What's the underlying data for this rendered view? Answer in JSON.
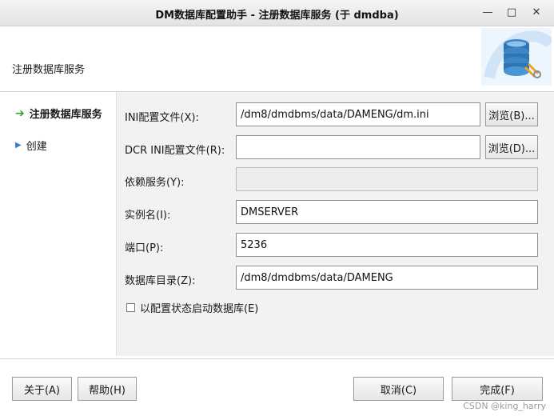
{
  "window": {
    "title": "DM数据库配置助手 - 注册数据库服务 (于 dmdba)",
    "minimize_glyph": "—",
    "maximize_glyph": "□",
    "close_glyph": "✕"
  },
  "header": {
    "title": "注册数据库服务",
    "logo_icon": "database-gear-icon"
  },
  "nav": {
    "items": [
      {
        "label": "注册数据库服务",
        "state": "active",
        "icon": "arrow-right-icon",
        "glyph": "➔",
        "color": "#2e9e3a"
      },
      {
        "label": "创建",
        "state": "pending",
        "icon": "triangle-right-icon",
        "glyph": "▶",
        "color": "#3a7bd5"
      }
    ]
  },
  "form": {
    "ini_file": {
      "label": "INI配置文件(X):",
      "value": "/dm8/dmdbms/data/DAMENG/dm.ini",
      "browse_label": "浏览(B)..."
    },
    "dcr_ini_file": {
      "label": "DCR INI配置文件(R):",
      "value": "",
      "browse_label": "浏览(D)..."
    },
    "dependency_service": {
      "label": "依赖服务(Y):",
      "value": ""
    },
    "instance_name": {
      "label": "实例名(I):",
      "value": "DMSERVER"
    },
    "port": {
      "label": "端口(P):",
      "value": "5236"
    },
    "db_dir": {
      "label": "数据库目录(Z):",
      "value": "/dm8/dmdbms/data/DAMENG"
    },
    "start_config_checkbox": {
      "label": "以配置状态启动数据库(E)",
      "checked": false
    }
  },
  "footer": {
    "about_label": "关于(A)",
    "help_label": "帮助(H)",
    "cancel_label": "取消(C)",
    "finish_label": "完成(F)"
  },
  "watermark": "CSDN @king_harry"
}
